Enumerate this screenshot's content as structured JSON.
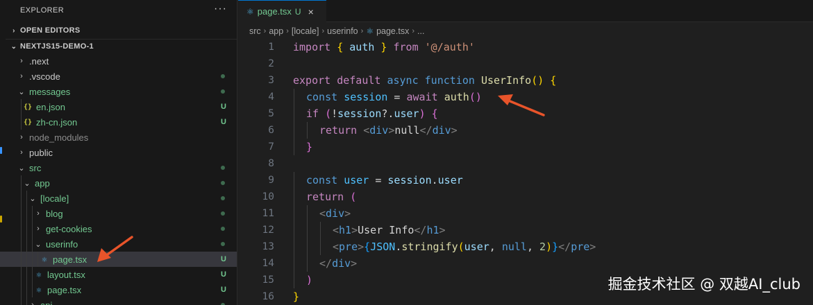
{
  "sidebar": {
    "header": "EXPLORER",
    "more": "···",
    "open_editors": "OPEN EDITORS",
    "project": "NEXTJS15-DEMO-1",
    "items": [
      {
        "label": ".next",
        "chev": "›",
        "kind": "folder",
        "depth": 0,
        "status": "",
        "tone": "normal"
      },
      {
        "label": ".vscode",
        "chev": "›",
        "kind": "folder",
        "depth": 0,
        "status": "dot",
        "tone": "normal"
      },
      {
        "label": "messages",
        "chev": "⌄",
        "kind": "folder",
        "depth": 0,
        "status": "dot",
        "tone": "green"
      },
      {
        "label": "en.json",
        "chev": "",
        "kind": "json",
        "icon": "{}",
        "depth": 1,
        "status": "U",
        "tone": "green"
      },
      {
        "label": "zh-cn.json",
        "chev": "",
        "kind": "json",
        "icon": "{}",
        "depth": 1,
        "status": "U",
        "tone": "green"
      },
      {
        "label": "node_modules",
        "chev": "›",
        "kind": "folder",
        "depth": 0,
        "status": "",
        "tone": "dim"
      },
      {
        "label": "public",
        "chev": "›",
        "kind": "folder",
        "depth": 0,
        "status": "",
        "tone": "normal"
      },
      {
        "label": "src",
        "chev": "⌄",
        "kind": "folder",
        "depth": 0,
        "status": "dot",
        "tone": "green"
      },
      {
        "label": "app",
        "chev": "⌄",
        "kind": "folder",
        "depth": 1,
        "status": "dot",
        "tone": "green"
      },
      {
        "label": "[locale]",
        "chev": "⌄",
        "kind": "folder",
        "depth": 2,
        "status": "dot",
        "tone": "green"
      },
      {
        "label": "blog",
        "chev": "›",
        "kind": "folder",
        "depth": 3,
        "status": "dot",
        "tone": "green"
      },
      {
        "label": "get-cookies",
        "chev": "›",
        "kind": "folder",
        "depth": 3,
        "status": "dot",
        "tone": "green"
      },
      {
        "label": "userinfo",
        "chev": "⌄",
        "kind": "folder",
        "depth": 3,
        "status": "dot",
        "tone": "green"
      },
      {
        "label": "page.tsx",
        "chev": "",
        "kind": "react",
        "icon": "⚛",
        "depth": 4,
        "status": "U",
        "tone": "green",
        "selected": true
      },
      {
        "label": "layout.tsx",
        "chev": "",
        "kind": "react",
        "icon": "⚛",
        "depth": 3,
        "status": "U",
        "tone": "green"
      },
      {
        "label": "page.tsx",
        "chev": "",
        "kind": "react",
        "icon": "⚛",
        "depth": 3,
        "status": "U",
        "tone": "green"
      },
      {
        "label": "api",
        "chev": "›",
        "kind": "folder",
        "depth": 2,
        "status": "dot",
        "tone": "green"
      }
    ]
  },
  "tab": {
    "icon": "react-icon",
    "glyph": "⚛",
    "name": "page.tsx",
    "badge": "U",
    "close": "×"
  },
  "breadcrumb": [
    "src",
    "app",
    "[locale]",
    "userinfo",
    "page.tsx",
    "..."
  ],
  "code": [
    {
      "n": "1",
      "indent": 0,
      "tokens": [
        [
          "import ",
          "kw"
        ],
        [
          "{ ",
          "b1"
        ],
        [
          "auth",
          "var"
        ],
        [
          " }",
          "b1"
        ],
        [
          " from ",
          "kw"
        ],
        [
          "'@/auth'",
          "str"
        ]
      ]
    },
    {
      "n": "2",
      "indent": 0,
      "tokens": []
    },
    {
      "n": "3",
      "indent": 0,
      "tokens": [
        [
          "export ",
          "kw"
        ],
        [
          "default ",
          "kw"
        ],
        [
          "async ",
          "kw2"
        ],
        [
          "function ",
          "kw2"
        ],
        [
          "UserInfo",
          "fn"
        ],
        [
          "()",
          "b1"
        ],
        [
          " ",
          "p"
        ],
        [
          "{",
          "b1"
        ]
      ]
    },
    {
      "n": "4",
      "indent": 1,
      "tokens": [
        [
          "const ",
          "kw2"
        ],
        [
          "session",
          "const"
        ],
        [
          " = ",
          "p"
        ],
        [
          "await ",
          "kw"
        ],
        [
          "auth",
          "fn"
        ],
        [
          "()",
          "b2"
        ]
      ]
    },
    {
      "n": "5",
      "indent": 1,
      "tokens": [
        [
          "if ",
          "kw"
        ],
        [
          "(",
          "b2"
        ],
        [
          "!",
          "p"
        ],
        [
          "session",
          "var"
        ],
        [
          "?.",
          "p"
        ],
        [
          "user",
          "var"
        ],
        [
          ")",
          "b2"
        ],
        [
          " ",
          "p"
        ],
        [
          "{",
          "b2"
        ]
      ]
    },
    {
      "n": "6",
      "indent": 2,
      "tokens": [
        [
          "return ",
          "kw"
        ],
        [
          "<",
          "ang"
        ],
        [
          "div",
          "tag"
        ],
        [
          ">",
          "ang"
        ],
        [
          "null",
          "p"
        ],
        [
          "</",
          "ang"
        ],
        [
          "div",
          "tag"
        ],
        [
          ">",
          "ang"
        ]
      ]
    },
    {
      "n": "7",
      "indent": 1,
      "tokens": [
        [
          "}",
          "b2"
        ]
      ]
    },
    {
      "n": "8",
      "indent": 0,
      "tokens": []
    },
    {
      "n": "9",
      "indent": 1,
      "tokens": [
        [
          "const ",
          "kw2"
        ],
        [
          "user",
          "const"
        ],
        [
          " = ",
          "p"
        ],
        [
          "session",
          "var"
        ],
        [
          ".",
          "p"
        ],
        [
          "user",
          "var"
        ]
      ]
    },
    {
      "n": "10",
      "indent": 1,
      "tokens": [
        [
          "return ",
          "kw"
        ],
        [
          "(",
          "b2"
        ]
      ]
    },
    {
      "n": "11",
      "indent": 2,
      "tokens": [
        [
          "<",
          "ang"
        ],
        [
          "div",
          "tag"
        ],
        [
          ">",
          "ang"
        ]
      ]
    },
    {
      "n": "12",
      "indent": 3,
      "tokens": [
        [
          "<",
          "ang"
        ],
        [
          "h1",
          "tag"
        ],
        [
          ">",
          "ang"
        ],
        [
          "User Info",
          "p"
        ],
        [
          "</",
          "ang"
        ],
        [
          "h1",
          "tag"
        ],
        [
          ">",
          "ang"
        ]
      ]
    },
    {
      "n": "13",
      "indent": 3,
      "tokens": [
        [
          "<",
          "ang"
        ],
        [
          "pre",
          "tag"
        ],
        [
          ">",
          "ang"
        ],
        [
          "{",
          "b3"
        ],
        [
          "JSON",
          "const"
        ],
        [
          ".",
          "p"
        ],
        [
          "stringify",
          "fn"
        ],
        [
          "(",
          "b1"
        ],
        [
          "user",
          "var"
        ],
        [
          ", ",
          "p"
        ],
        [
          "null",
          "kw2"
        ],
        [
          ", ",
          "p"
        ],
        [
          "2",
          "num"
        ],
        [
          ")",
          "b1"
        ],
        [
          "}",
          "b3"
        ],
        [
          "</",
          "ang"
        ],
        [
          "pre",
          "tag"
        ],
        [
          ">",
          "ang"
        ]
      ]
    },
    {
      "n": "14",
      "indent": 2,
      "tokens": [
        [
          "</",
          "ang"
        ],
        [
          "div",
          "tag"
        ],
        [
          ">",
          "ang"
        ]
      ]
    },
    {
      "n": "15",
      "indent": 1,
      "tokens": [
        [
          ")",
          "b2"
        ]
      ]
    },
    {
      "n": "16",
      "indent": 0,
      "tokens": [
        [
          "}",
          "b1"
        ]
      ]
    }
  ],
  "watermark": "掘金技术社区 @ 双越AI_club",
  "colors": {
    "accent": "#0078d4",
    "untracked": "#73c991",
    "annotation_arrow": "#e8542a"
  }
}
